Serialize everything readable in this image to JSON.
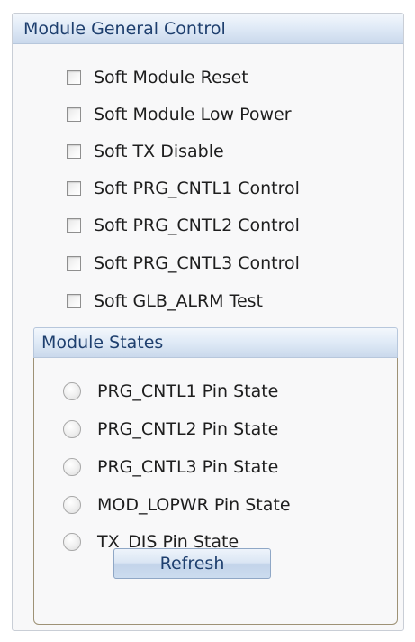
{
  "general": {
    "title": "Module General Control",
    "checkboxes": [
      {
        "label": "Soft Module Reset",
        "checked": false
      },
      {
        "label": "Soft Module Low Power",
        "checked": false
      },
      {
        "label": "Soft TX Disable",
        "checked": false
      },
      {
        "label": "Soft PRG_CNTL1 Control",
        "checked": false
      },
      {
        "label": "Soft PRG_CNTL2 Control",
        "checked": false
      },
      {
        "label": "Soft PRG_CNTL3 Control",
        "checked": false
      },
      {
        "label": "Soft GLB_ALRM Test",
        "checked": false
      }
    ]
  },
  "states": {
    "title": "Module States",
    "indicators": [
      {
        "label": "PRG_CNTL1 Pin State",
        "on": false
      },
      {
        "label": "PRG_CNTL2 Pin State",
        "on": false
      },
      {
        "label": "PRG_CNTL3 Pin State",
        "on": false
      },
      {
        "label": "MOD_LOPWR Pin State",
        "on": false
      },
      {
        "label": "TX_DIS Pin State",
        "on": false
      }
    ],
    "refresh_label": "Refresh"
  }
}
